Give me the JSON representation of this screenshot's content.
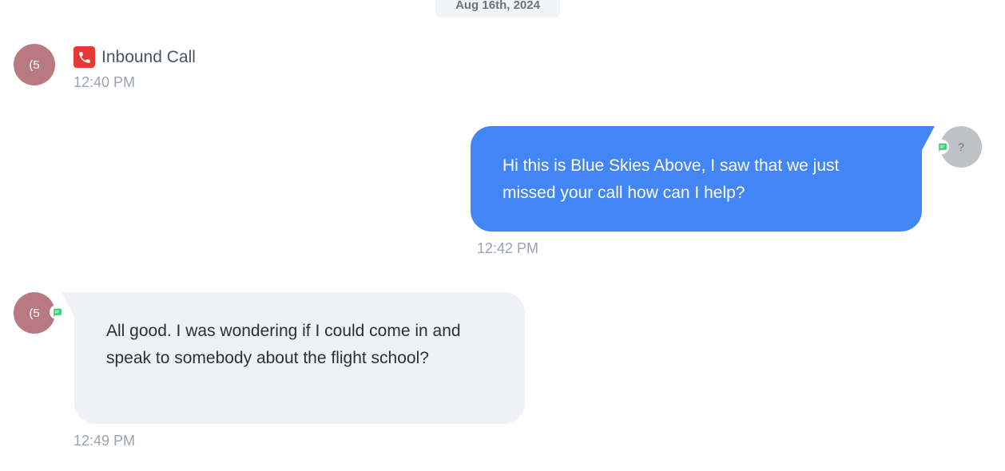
{
  "date_divider": "Aug 16th, 2024",
  "events": [
    {
      "type": "inbound-call",
      "avatar_text": "(5",
      "icon": "phone-icon",
      "title": "Inbound Call",
      "time": "12:40 PM"
    }
  ],
  "messages": [
    {
      "direction": "outgoing",
      "avatar_text": "?",
      "channel_icon": "sms-icon",
      "text": "Hi this is Blue Skies Above, I saw that we just missed your call how can I help?",
      "time": "12:42 PM"
    },
    {
      "direction": "incoming",
      "avatar_text": "(5",
      "channel_icon": "sms-icon",
      "text": "All good. I was wondering if I could come in and speak to somebody about the flight school?",
      "time": "12:49 PM"
    }
  ],
  "colors": {
    "outgoing_bubble": "#4285f4",
    "incoming_bubble": "#f0f1f5",
    "contact_avatar": "#b87a80",
    "agent_avatar": "#bfc3c8",
    "call_icon": "#e53935",
    "channel_badge": "#3ecf7a"
  }
}
